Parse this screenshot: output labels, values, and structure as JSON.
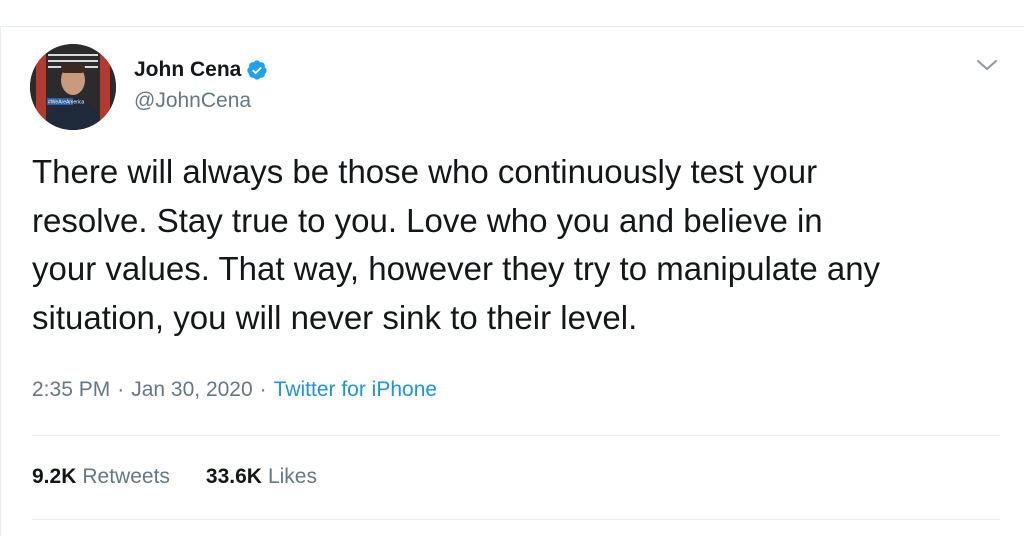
{
  "author": {
    "display_name": "John Cena",
    "handle": "@JohnCena",
    "verified": true,
    "avatar_badge_text": "#WeAreAmerica"
  },
  "tweet": {
    "text": "There will always be those who continuously test your\nresolve. Stay true to you. Love who you and believe in\nyour values. That way, however they try to manipulate any\nsituation, you will never sink to their level.",
    "time": "2:35 PM",
    "date": "Jan 30, 2020",
    "source": "Twitter for iPhone",
    "separator": "·"
  },
  "stats": {
    "retweets_count": "9.2K",
    "retweets_label": "Retweets",
    "likes_count": "33.6K",
    "likes_label": "Likes"
  },
  "icons": {
    "verified": "verified-badge-icon",
    "menu": "chevron-down-icon"
  },
  "colors": {
    "accent": "#1DA1F2",
    "link": "#1B95E0",
    "secondary_text": "#657786",
    "primary_text": "#14171A",
    "divider": "#E6ECF0"
  }
}
